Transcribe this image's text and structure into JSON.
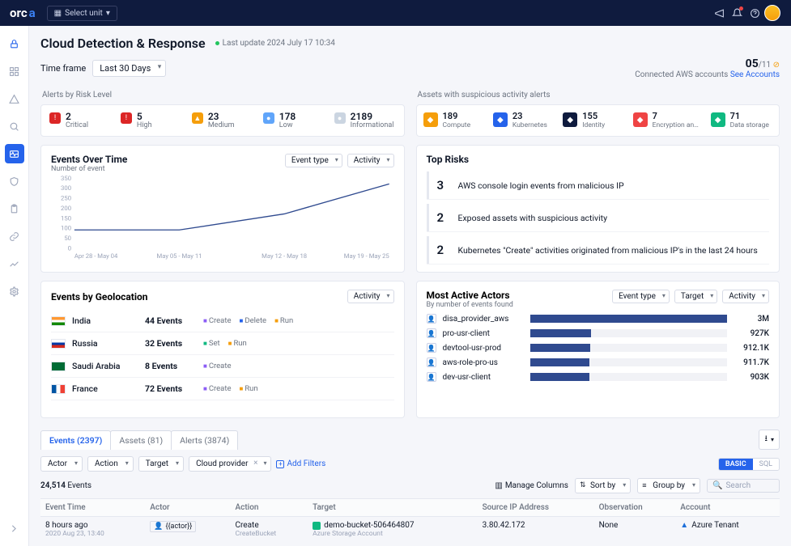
{
  "topbar": {
    "logo_a": "orc",
    "logo_b": "a",
    "unit_select": "Select unit"
  },
  "page": {
    "title": "Cloud Detection & Response",
    "last_update": "Last update 2024 July 17 10:34",
    "time_frame_label": "Time frame",
    "time_frame_value": "Last 30 Days"
  },
  "accounts": {
    "count": "05",
    "total": "/11",
    "label": "Connected AWS accounts",
    "link": "See Accounts"
  },
  "risk_section_label": "Alerts by Risk Level",
  "risk_levels": [
    {
      "count": "2",
      "label": "Critical",
      "color": "#dc2626",
      "icon": "!"
    },
    {
      "count": "5",
      "label": "High",
      "color": "#dc2626",
      "icon": "!"
    },
    {
      "count": "23",
      "label": "Medium",
      "color": "#f59e0b",
      "icon": "▲"
    },
    {
      "count": "178",
      "label": "Low",
      "color": "#60a5fa",
      "icon": "●"
    },
    {
      "count": "2189",
      "label": "Informational",
      "color": "#cbd5e1",
      "icon": "●"
    }
  ],
  "asset_section_label": "Assets with suspicious activity alerts",
  "asset_types": [
    {
      "count": "189",
      "label": "Compute",
      "color": "#f59e0b"
    },
    {
      "count": "23",
      "label": "Kubernetes",
      "color": "#2563eb"
    },
    {
      "count": "155",
      "label": "Identity",
      "color": "#0f1b3e"
    },
    {
      "count": "7",
      "label": "Encryption and se…",
      "color": "#ef4444"
    },
    {
      "count": "71",
      "label": "Data storage",
      "color": "#10b981"
    }
  ],
  "events_over_time": {
    "title": "Events Over Time",
    "subtitle": "Number of event",
    "sel_event_type": "Event type",
    "sel_activity": "Activity"
  },
  "chart_data": {
    "type": "line",
    "title": "Events Over Time",
    "ylabel": "Number of event",
    "ylim": [
      0,
      350
    ],
    "yticks": [
      0,
      50,
      100,
      150,
      200,
      250,
      300,
      350
    ],
    "categories": [
      "Apr 28 - May 04",
      "May 05 - May 11",
      "May 12 - May 18",
      "May 19 - May 25"
    ],
    "values": [
      90,
      90,
      170,
      320
    ]
  },
  "top_risks": {
    "title": "Top Risks",
    "items": [
      {
        "count": "3",
        "text": "AWS console login events from malicious IP"
      },
      {
        "count": "2",
        "text": "Exposed assets with suspicious activity"
      },
      {
        "count": "2",
        "text": "Kubernetes \"Create\" activities originated from malicious IP's in the last 24 hours"
      }
    ]
  },
  "geo": {
    "title": "Events by Geolocation",
    "sel_activity": "Activity",
    "rows": [
      {
        "country": "India",
        "flag": "india",
        "events": "44 Events",
        "tags": [
          "Create",
          "Delete",
          "Run"
        ]
      },
      {
        "country": "Russia",
        "flag": "russia",
        "events": "32 Events",
        "tags": [
          "Set",
          "Run"
        ]
      },
      {
        "country": "Saudi Arabia",
        "flag": "saudi",
        "events": "8 Events",
        "tags": [
          "Create"
        ]
      },
      {
        "country": "France",
        "flag": "france",
        "events": "72 Events",
        "tags": [
          "Create",
          "Run"
        ]
      }
    ]
  },
  "actors": {
    "title": "Most Active Actors",
    "subtitle": "By number of events found",
    "sel_event_type": "Event type",
    "sel_target": "Target",
    "sel_activity": "Activity",
    "max": 3000000,
    "rows": [
      {
        "name": "disa_provider_aws",
        "value": 3000000,
        "display": "3M"
      },
      {
        "name": "pro-usr-client",
        "value": 927000,
        "display": "927K"
      },
      {
        "name": "devtool-usr-prod",
        "value": 912100,
        "display": "912.1K"
      },
      {
        "name": "aws-role-pro-us",
        "value": 911700,
        "display": "911.7K"
      },
      {
        "name": "dev-usr-client",
        "value": 903000,
        "display": "903K"
      }
    ]
  },
  "lower": {
    "tabs": [
      {
        "label": "Events (2397)",
        "active": true
      },
      {
        "label": "Assets (81)",
        "active": false
      },
      {
        "label": "Alerts (3874)",
        "active": false
      }
    ],
    "filters": {
      "actor": "Actor",
      "action": "Action",
      "target": "Target",
      "cloud": "Cloud provider",
      "add": "Add Filters",
      "mode_basic": "BASIC",
      "mode_sql": "SQL"
    },
    "toolbar": {
      "count": "24,514",
      "count_label": "Events",
      "manage_cols": "Manage Columns",
      "sort_by": "Sort by",
      "group_by": "Group by",
      "search_ph": "Search"
    },
    "columns": [
      "Event Time",
      "Actor",
      "Action",
      "Target",
      "Source IP Address",
      "Observation",
      "Account"
    ],
    "row": {
      "time_rel": "8 hours ago",
      "time_abs": "2020 Aug 23, 13:40",
      "actor": "{{actor}}",
      "action": "Create",
      "action_sub": "CreateBucket",
      "target": "demo-bucket-506464807",
      "target_sub": "Azure Storage Account",
      "source_ip": "3.80.42.172",
      "observation": "None",
      "account": "Azure Tenant"
    }
  }
}
